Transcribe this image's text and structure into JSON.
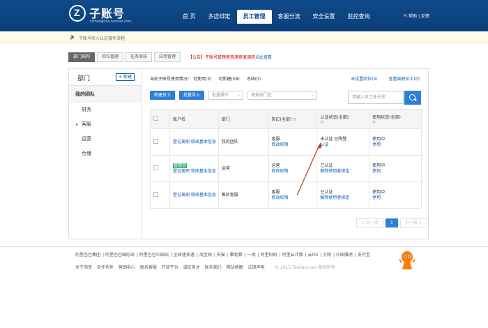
{
  "header": {
    "brand": "子账号",
    "brand_sub": "zizhanghao.taobao.com",
    "nav": [
      "首 页",
      "多店绑定",
      "员工管理",
      "客服分流",
      "安全设置",
      "监控查询"
    ],
    "help": "帮助 | 反馈"
  },
  "notice": {
    "text": "子账号实人认证操作流程"
  },
  "tabs": [
    "部门结构",
    "岗位管理",
    "任务审核",
    "应用管理"
  ],
  "announcement": {
    "prefix": "【公告】子账号管理使用满意度调研",
    "link": "点此查看"
  },
  "sidebar": {
    "title": "部门",
    "new_button": "新建",
    "items": [
      {
        "label": "我的团队"
      },
      {
        "label": "财务"
      },
      {
        "label": "客服"
      },
      {
        "label": "运营"
      },
      {
        "label": "仓储"
      }
    ]
  },
  "stats": {
    "available": "当前子账号使用情况： 可使用(3)",
    "usable": "可新建(58)",
    "frozen": "冻结(0)"
  },
  "quick_links": [
    "未设置岗位(0)",
    "查看离职员工(0)"
  ],
  "toolbar": {
    "new_employee": "新建员工",
    "import": "批量导入",
    "bulk_ops": "批量操作",
    "change_dept": "更换部门至",
    "search_placeholder": "请输入员工账号名"
  },
  "table": {
    "headers": [
      "账户名",
      "部门",
      "岗位(全部)",
      "认证状态(全部)",
      "使用状态(全部)"
    ],
    "rows": [
      {
        "tag": "",
        "account_links": "登记离职 修改基本信息",
        "dept": "我的团队",
        "post": "客服",
        "post_link": "修改权限",
        "cert": "未认证 已降登",
        "cert_link": "认证",
        "status": "使用中",
        "status_link": "停用"
      },
      {
        "tag": "管理员",
        "account_links": "登记离职 修改基本信息",
        "dept": "运营",
        "post": "运营",
        "post_link": "修改权限",
        "cert": "已认证",
        "cert_link": "解除使用者绑定",
        "status": "使用中",
        "status_link": "停用"
      },
      {
        "tag": "",
        "account_links": "登记离职 修改基本信息",
        "dept": "售后客服",
        "post": "客服",
        "post_link": "修改权限",
        "cert": "已认证",
        "cert_link": "解除使用者绑定",
        "status": "使用中",
        "status_link": "停用"
      }
    ]
  },
  "pager": {
    "prev": "< 上一页",
    "current": "1",
    "next": "下一页 >"
  },
  "footer": {
    "links": [
      "阿里巴巴集团",
      "阿里巴巴国际站",
      "阿里巴巴中国站",
      "全球速卖通",
      "淘宝网",
      "天猫",
      "聚划算",
      "一淘",
      "阿里妈妈",
      "阿里云计算",
      "云OS",
      "万网",
      "中国雅虎",
      "支付宝"
    ],
    "links2": [
      "关于淘宝",
      "合作伙伴",
      "营销中心",
      "联系客服",
      "开放平台",
      "诚征英才",
      "联系我们",
      "网站地图",
      "法律声明"
    ],
    "copyright": "© 2015 Taobao.com 版权所有"
  },
  "colors": {
    "header": "#0f4a8a",
    "accent": "#2f7fd7",
    "link": "#0b5cad",
    "annotation": "#c0392b"
  }
}
